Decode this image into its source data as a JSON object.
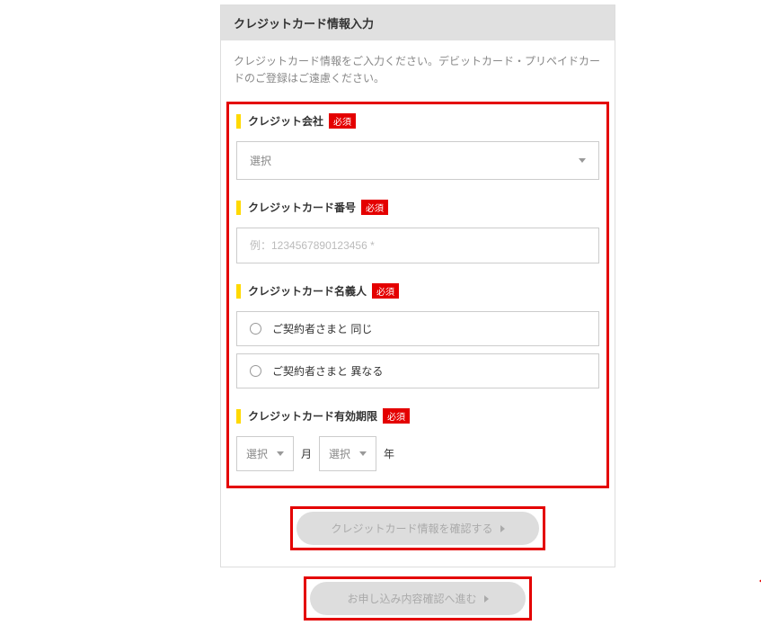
{
  "header": {
    "title": "クレジットカード情報入力"
  },
  "instruction": "クレジットカード情報をご入力ください。デビットカード・プリペイドカードのご登録はご遠慮ください。",
  "required_label": "必須",
  "fields": {
    "company": {
      "label": "クレジット会社",
      "placeholder": "選択"
    },
    "number": {
      "label": "クレジットカード番号",
      "placeholder": "例：1234567890123456 *"
    },
    "holder": {
      "label": "クレジットカード名義人",
      "option_same": "ご契約者さまと 同じ",
      "option_diff": "ご契約者さまと 異なる"
    },
    "expiry": {
      "label": "クレジットカード有効期限",
      "month_placeholder": "選択",
      "year_placeholder": "選択",
      "month_unit": "月",
      "year_unit": "年"
    }
  },
  "buttons": {
    "confirm_card": "クレジットカード情報を確認する",
    "proceed": "お申し込み内容確認へ進む"
  }
}
